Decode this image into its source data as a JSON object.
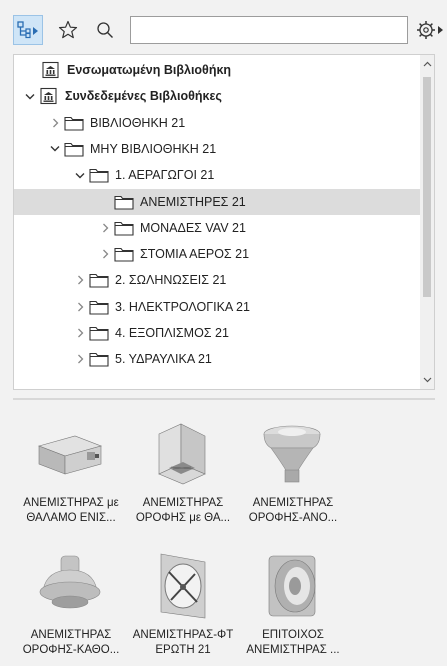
{
  "search": {
    "value": "",
    "placeholder": ""
  },
  "icons": {
    "tree_view": "tree-view-icon",
    "favorites": "star-icon",
    "search": "search-icon",
    "settings": "gear-icon"
  },
  "tree": {
    "rows": [
      {
        "label": "Ενσωματωμένη Βιβλιοθήκη",
        "type": "embedded-library",
        "expanded": null,
        "bold": true
      },
      {
        "label": "Συνδεδεμένες Βιβλιοθήκες",
        "type": "linked-libraries",
        "expanded": true,
        "bold": true
      },
      {
        "label": "ΒΙΒΛΙΟΘΗΚΗ 21",
        "type": "folder",
        "expanded": false
      },
      {
        "label": "ΜΗΥ ΒΙΒΛΙΟΘΗΚΗ 21",
        "type": "folder",
        "expanded": true
      },
      {
        "label": "1. ΑΕΡΑΓΩΓΟΙ 21",
        "type": "folder",
        "expanded": true
      },
      {
        "label": "ΑΝΕΜΙΣΤΗΡΕΣ 21",
        "type": "folder",
        "expanded": null,
        "selected": true
      },
      {
        "label": "ΜΟΝΑΔΕΣ VAV 21",
        "type": "folder",
        "expanded": false
      },
      {
        "label": "ΣΤΟΜΙΑ ΑΕΡΟΣ 21",
        "type": "folder",
        "expanded": false
      },
      {
        "label": "2. ΣΩΛΗΝΩΣΕΙΣ 21",
        "type": "folder",
        "expanded": false
      },
      {
        "label": "3. ΗΛΕΚΤΡΟΛΟΓΙΚΑ 21",
        "type": "folder",
        "expanded": false
      },
      {
        "label": "4. ΕΞΟΠΛΙΣΜΟΣ 21",
        "type": "folder",
        "expanded": false
      },
      {
        "label": "5. ΥΔΡΑΥΛΙΚΑ 21",
        "type": "folder",
        "expanded": false
      }
    ]
  },
  "items": [
    {
      "line1": "ΑΝΕΜΙΣΤΗΡΑΣ με",
      "line2": "ΘΑΛΑΜΟ ΕΝΙΣ...",
      "icon": "box-fan-icon"
    },
    {
      "line1": "ΑΝΕΜΙΣΤΗΡΑΣ",
      "line2": "ΟΡΟΦΗΣ με ΘΑ...",
      "icon": "roof-fan-chamber-icon"
    },
    {
      "line1": "ΑΝΕΜΙΣΤΗΡΑΣ",
      "line2": "ΟΡΟΦΗΣ-ΑΝΟ...",
      "icon": "roof-fan-up-icon"
    },
    {
      "line1": "ΑΝΕΜΙΣΤΗΡΑΣ",
      "line2": "ΟΡΟΦΗΣ-ΚΑΘΟ...",
      "icon": "roof-fan-down-icon"
    },
    {
      "line1": "ΑΝΕΜΙΣΤΗΡΑΣ-ΦΤ",
      "line2": "ΕΡΩΤΗ 21",
      "icon": "propeller-fan-icon"
    },
    {
      "line1": "ΕΠΙΤΟΙΧΟΣ",
      "line2": "ΑΝΕΜΙΣΤΗΡΑΣ ...",
      "icon": "wall-fan-icon"
    }
  ]
}
